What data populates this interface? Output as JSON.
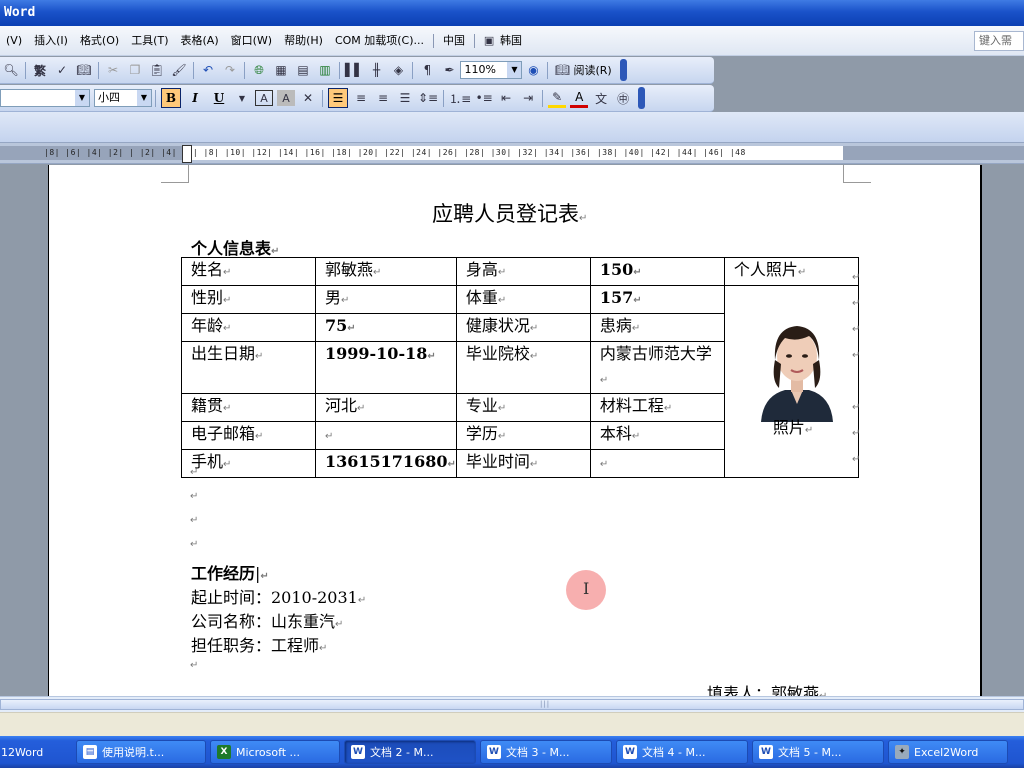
{
  "window": {
    "title": "Word"
  },
  "menu": {
    "items": [
      "(V)",
      "插入(I)",
      "格式(O)",
      "工具(T)",
      "表格(A)",
      "窗口(W)",
      "帮助(H)",
      "COM 加载项(C)...",
      "中国",
      "韩国"
    ],
    "help_placeholder": "键入需"
  },
  "toolbar": {
    "zoom": "110%",
    "read_label": "阅读(R)",
    "font_size": "小四",
    "traditional": "繁"
  },
  "ruler": {
    "text": "|8| |6| |4| |2| | |2| |4| |6| |8| |10| |12| |14| |16| |18| |20| |22| |24| |26| |28| |30| |32| |34| |36| |38| |40| |42| |44| |46| |48"
  },
  "document": {
    "title": "应聘人员登记表",
    "section_personal": "个人信息表",
    "table": [
      [
        "姓名",
        "郭敏燕",
        "身高",
        "150",
        "个人照片"
      ],
      [
        "性别",
        "男",
        "体重",
        "157"
      ],
      [
        "年龄",
        "75",
        "健康状况",
        "患病"
      ],
      [
        "出生日期",
        "1999-10-18",
        "毕业院校",
        "内蒙古师范大学"
      ],
      [
        "籍贯",
        "河北",
        "专业",
        "材料工程"
      ],
      [
        "电子邮箱",
        "",
        "学历",
        "本科"
      ],
      [
        "手机",
        "13615171680",
        "毕业时间",
        ""
      ]
    ],
    "photo_caption": "照片",
    "section_work": "工作经历",
    "work": {
      "period": "起止时间：2010-2031",
      "company": "公司名称：山东重汽",
      "position": "担任职务：工程师"
    },
    "filler": "填表人：郭敏燕"
  },
  "taskbar": {
    "items": [
      {
        "label": "12Word",
        "icon": "word-icon",
        "active": false
      },
      {
        "label": "使用说明.t...",
        "icon": "notepad-icon",
        "active": false
      },
      {
        "label": "Microsoft ...",
        "icon": "excel-icon",
        "active": false
      },
      {
        "label": "文档 2 - M...",
        "icon": "word-doc-icon",
        "active": true
      },
      {
        "label": "文档 3 - M...",
        "icon": "word-doc-icon",
        "active": false
      },
      {
        "label": "文档 4 - M...",
        "icon": "word-doc-icon",
        "active": false
      },
      {
        "label": "文档 5 - M...",
        "icon": "word-doc-icon",
        "active": false
      },
      {
        "label": "Excel2Word",
        "icon": "excel2word-icon",
        "active": false
      }
    ]
  },
  "colors": {
    "titlebar": "#1a52c9",
    "taskbar": "#245edb",
    "page_bg": "#ffffff",
    "workspace": "#8f9aa8"
  }
}
